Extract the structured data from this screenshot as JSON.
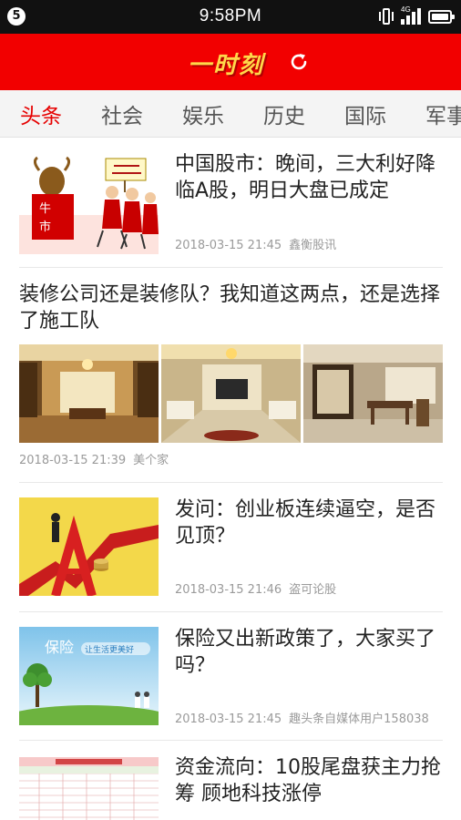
{
  "status_bar": {
    "badge": "5",
    "time": "9:58PM",
    "network": "4G"
  },
  "header": {
    "logo_text": "一时刻"
  },
  "tabs": [
    {
      "label": "头条",
      "active": true
    },
    {
      "label": "社会",
      "active": false
    },
    {
      "label": "娱乐",
      "active": false
    },
    {
      "label": "历史",
      "active": false
    },
    {
      "label": "国际",
      "active": false
    },
    {
      "label": "军事",
      "active": false
    }
  ],
  "feed": [
    {
      "title": "中国股市：晚间，三大利好降临A股，明日大盘已成定",
      "time": "2018-03-15 21:45",
      "source": "鑫衡股讯",
      "image": "bull-market-cartoon",
      "image_text": [
        "牛",
        "市"
      ]
    },
    {
      "title": "装修公司还是装修队？我知道这两点，还是选择了施工队",
      "time": "2018-03-15 21:39",
      "source": "美个家",
      "images": [
        "interior-photo-1",
        "interior-photo-2",
        "interior-photo-3"
      ]
    },
    {
      "title": "发问：创业板连续逼空，是否见顶？",
      "time": "2018-03-15 21:46",
      "source": "盗可论股",
      "image": "stock-chart-illustration"
    },
    {
      "title": "保险又出新政策了，大家买了吗？",
      "time": "2018-03-15 21:45",
      "source": "趣头条自媒体用户158038",
      "image": "insurance-banner",
      "image_text": [
        "保险",
        "让生活更美好"
      ]
    },
    {
      "title": "资金流向：10股尾盘获主力抢筹 顾地科技涨停",
      "image": "data-table-screenshot"
    }
  ]
}
